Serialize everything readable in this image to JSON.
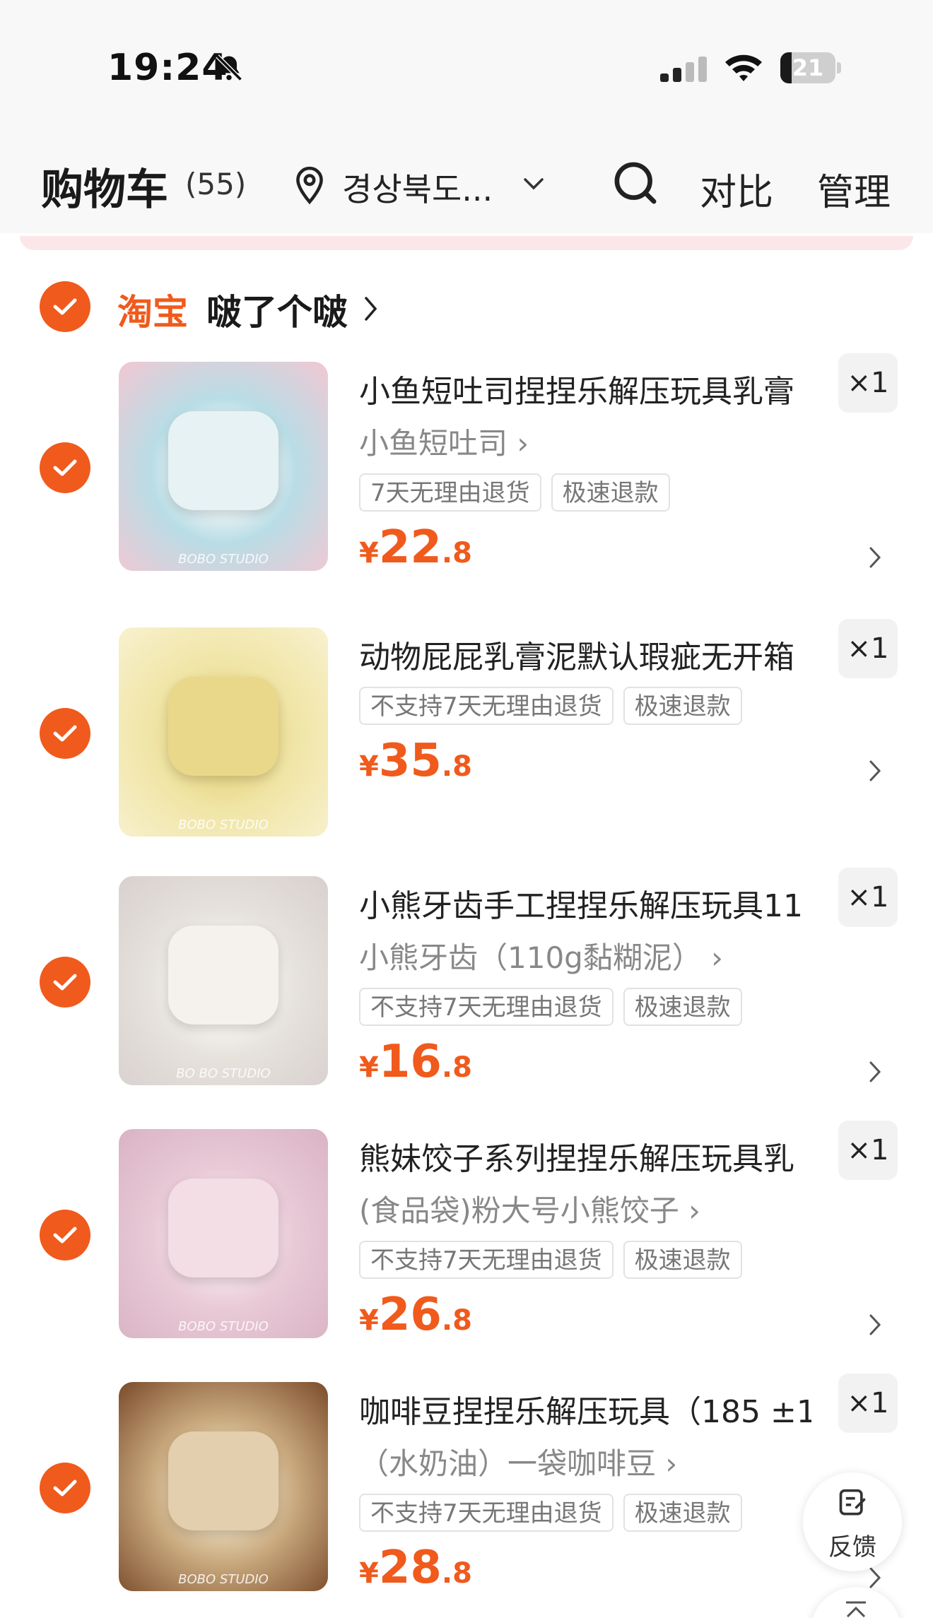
{
  "status_bar": {
    "time": "19:24",
    "battery_level": "21",
    "battery_fraction": 0.21
  },
  "header": {
    "title": "购物车",
    "count": "(55)",
    "location": "경상북도...",
    "compare_label": "对比",
    "manage_label": "管理"
  },
  "store": {
    "platform": "淘宝",
    "name": "啵了个啵"
  },
  "items": [
    {
      "title": "小鱼短吐司捏捏乐解压玩具乳膏",
      "variant": "小鱼短吐司 ›",
      "tags": [
        "7天无理由退货",
        "极速退款"
      ],
      "price_symbol": "¥",
      "price_int": "22",
      "price_dec": ".8",
      "qty": "×1",
      "thumb_caption": "BOBO STUDIO",
      "image_colors": [
        "#b9dde6",
        "#e7f2f4",
        "#f2c7d2"
      ]
    },
    {
      "title": "动物屁屁乳膏泥默认瑕疵无开箱",
      "variant": "",
      "tags": [
        "不支持7天无理由退货",
        "极速退款"
      ],
      "price_symbol": "¥",
      "price_int": "35",
      "price_dec": ".8",
      "qty": "×1",
      "thumb_caption": "BOBO STUDIO",
      "image_colors": [
        "#f0e5a6",
        "#e9d88a",
        "#f8f1cf"
      ]
    },
    {
      "title": "小熊牙齿手工捏捏乐解压玩具11",
      "variant": "小熊牙齿（110g黏糊泥） ›",
      "tags": [
        "不支持7天无理由退货",
        "极速退款"
      ],
      "price_symbol": "¥",
      "price_int": "16",
      "price_dec": ".8",
      "qty": "×1",
      "thumb_caption": "BO BO STUDIO",
      "image_colors": [
        "#e6e2dc",
        "#f5f2ee",
        "#d8d0cf"
      ]
    },
    {
      "title": "熊妹饺子系列捏捏乐解压玩具乳",
      "variant": "(食品袋)粉大号小熊饺子 ›",
      "tags": [
        "不支持7天无理由退货",
        "极速退款"
      ],
      "price_symbol": "¥",
      "price_int": "26",
      "price_dec": ".8",
      "qty": "×1",
      "thumb_caption": "BOBO STUDIO",
      "image_colors": [
        "#e8c9d6",
        "#f3dee6",
        "#d9b3c4"
      ]
    },
    {
      "title": "咖啡豆捏捏乐解压玩具（185 ±1",
      "variant": "（水奶油）一袋咖啡豆 ›",
      "tags": [
        "不支持7天无理由退货",
        "极速退款"
      ],
      "price_symbol": "¥",
      "price_int": "28",
      "price_dec": ".8",
      "qty": "×1",
      "thumb_caption": "BOBO STUDIO",
      "image_colors": [
        "#c9a97e",
        "#e3cfae",
        "#7a4b2a"
      ]
    }
  ],
  "feedback": {
    "label": "反馈"
  },
  "colors": {
    "accent": "#f05a1c",
    "tag_border": "#e2e2e2",
    "header_bg": "#f8f8f8"
  }
}
